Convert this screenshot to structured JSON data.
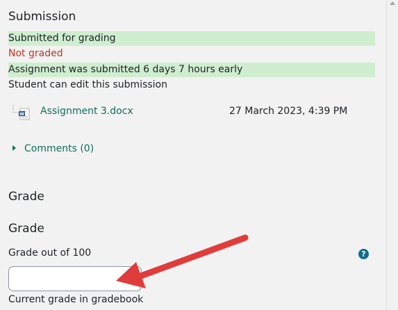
{
  "submission": {
    "heading": "Submission",
    "status_submitted": "Submitted for grading",
    "status_grading": "Not graded",
    "status_time": "Assignment was submitted 6 days 7 hours early",
    "status_edit": "Student can edit this submission",
    "file": {
      "name": "Assignment 3.docx",
      "date": "27 March 2023, 4:39 PM",
      "icon": "word-doc-icon"
    },
    "comments_label": "Comments (0)"
  },
  "grade": {
    "section_heading": "Grade",
    "sub_heading": "Grade",
    "field_label": "Grade out of 100",
    "help_icon": "question-help-icon",
    "help_symbol": "?",
    "input_value": "",
    "current_grade_label": "Current grade in gradebook"
  },
  "colors": {
    "success_bg": "#cfeecf",
    "danger_text": "#ca3120",
    "link": "#0f6e5a",
    "annotation_arrow": "#e03c3c"
  }
}
